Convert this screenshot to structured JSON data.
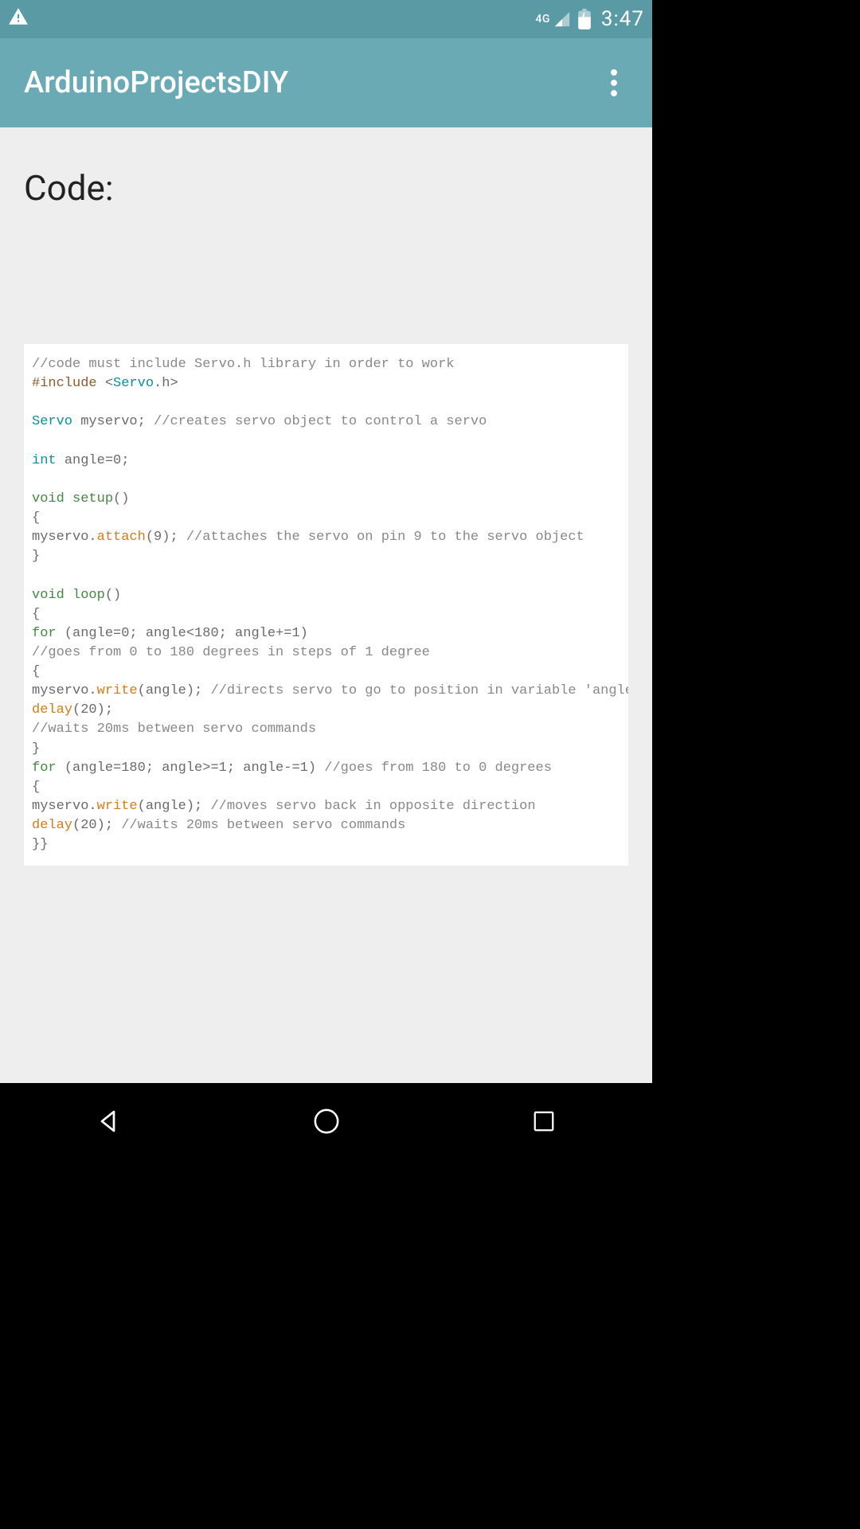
{
  "status": {
    "network_label": "4G",
    "time": "3:47"
  },
  "appbar": {
    "title": "ArduinoProjectsDIY"
  },
  "content": {
    "heading": "Code:"
  },
  "code": {
    "l1_comment": "//code must include Servo.h library in order to work",
    "l2_pre": "#include ",
    "l2_lt": "<",
    "l2_lib": "Servo",
    "l2_rest": ".h>",
    "l4_type": "Servo ",
    "l4_rest": "myservo; ",
    "l4_comment": "//creates servo object to control a servo",
    "l6_type": "int ",
    "l6_rest": "angle=0;",
    "l8_kw": "void ",
    "l8_fn": "setup",
    "l8_paren": "()",
    "l9_brace": "{",
    "l10_a": "myservo.",
    "l10_fn": "attach",
    "l10_b": "(9); ",
    "l10_comment": "//attaches the servo on pin 9 to the servo object",
    "l11_brace": "}",
    "l13_kw": "void ",
    "l13_fn": "loop",
    "l13_paren": "()",
    "l14_brace": "{",
    "l15_kw": "for ",
    "l15_rest": "(angle=0; angle<180; angle+=1)",
    "l16_comment": "//goes from 0 to 180 degrees in steps of 1 degree",
    "l17_brace": "{",
    "l18_a": "myservo.",
    "l18_fn": "write",
    "l18_b": "(angle); ",
    "l18_comment": "//directs servo to go to position in variable 'angle'",
    "l19_fn": "delay",
    "l19_b": "(20);",
    "l20_comment": "//waits 20ms between servo commands",
    "l21_brace": "}",
    "l22_kw": "for ",
    "l22_rest": "(angle=180; angle>=1; angle-=1) ",
    "l22_comment": "//goes from 180 to 0 degrees",
    "l23_brace": "{",
    "l24_a": "myservo.",
    "l24_fn": "write",
    "l24_b": "(angle); ",
    "l24_comment": "//moves servo back in opposite direction",
    "l25_fn": "delay",
    "l25_b": "(20); ",
    "l25_comment": "//waits 20ms between servo commands",
    "l26_brace": "}}"
  }
}
